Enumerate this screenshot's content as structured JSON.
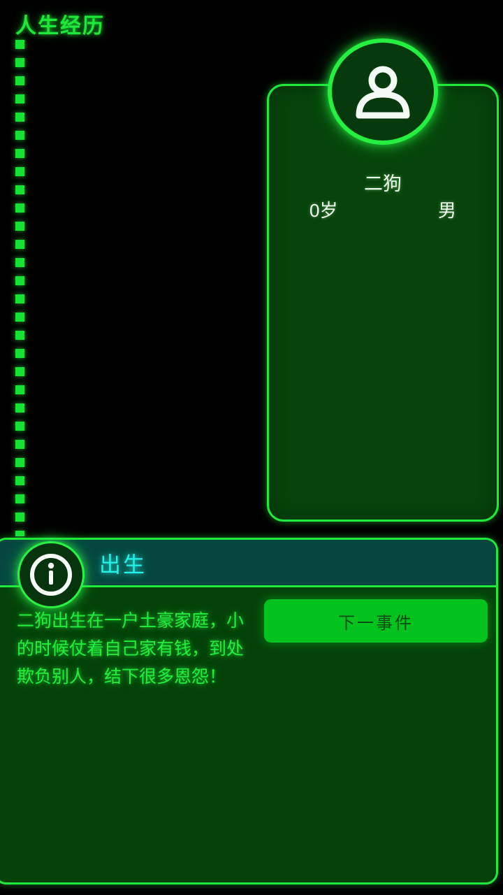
{
  "page": {
    "title": "人生经历",
    "background_color": "#000000",
    "accent_color": "#21e93c",
    "cyan_color": "#25f1e6"
  },
  "timeline": {
    "name": "life-timeline",
    "style": "dashed-vertical"
  },
  "character_card": {
    "avatar_icon": "person-avatar-icon",
    "name": "二狗",
    "age": "0岁",
    "gender": "男"
  },
  "event_panel": {
    "info_icon": "info-icon",
    "title": "出生",
    "body": "二狗出生在一户土豪家庭，小的时候仗着自己家有钱，到处欺负别人，结下很多恩怨！",
    "next_button_label": "下一事件"
  }
}
